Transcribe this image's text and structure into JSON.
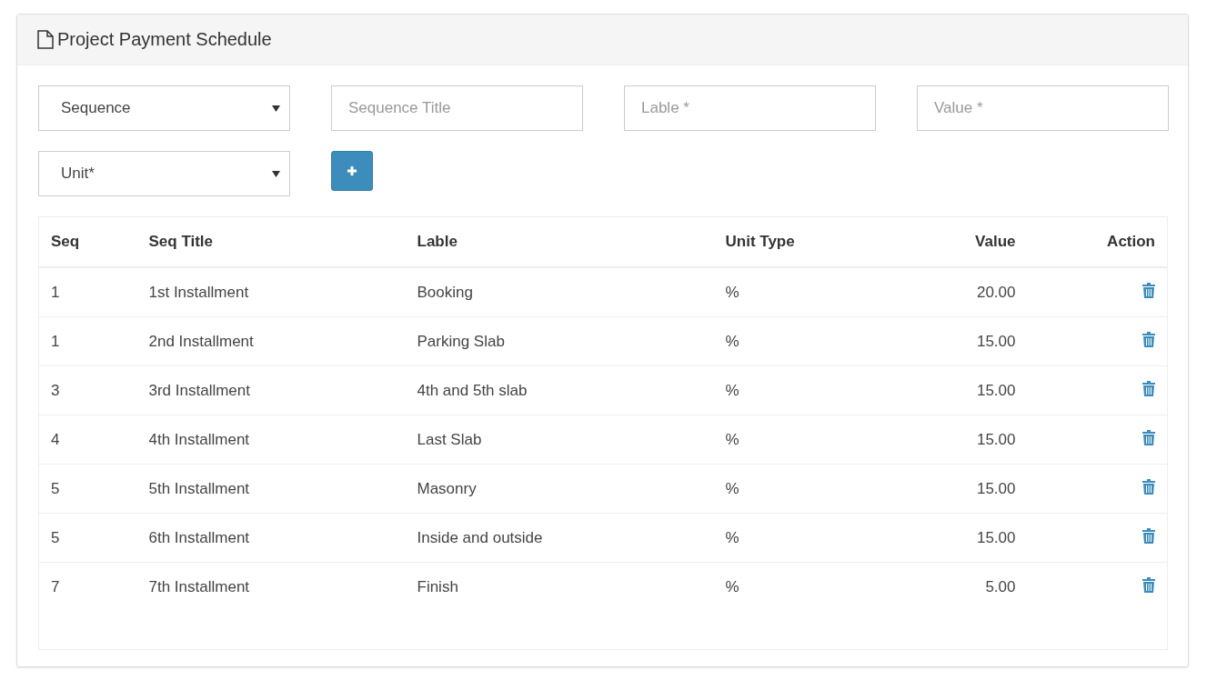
{
  "panel": {
    "title": "Project Payment Schedule"
  },
  "form": {
    "fields": [
      {
        "kind": "select",
        "value": "Sequence"
      },
      {
        "kind": "input",
        "placeholder": "Sequence Title"
      },
      {
        "kind": "input",
        "placeholder": "Lable *"
      },
      {
        "kind": "input",
        "placeholder": "Value *"
      },
      {
        "kind": "select",
        "value": "Unit*"
      },
      {
        "kind": "add"
      }
    ]
  },
  "table": {
    "columns": [
      "Seq",
      "Seq Title",
      "Lable",
      "Unit Type",
      "Value",
      "Action"
    ],
    "rows": [
      {
        "seq": "1",
        "title": "1st Installment",
        "label": "Booking",
        "unit": "%",
        "value": "20.00"
      },
      {
        "seq": "1",
        "title": "2nd Installment",
        "label": "Parking Slab",
        "unit": "%",
        "value": "15.00"
      },
      {
        "seq": "3",
        "title": "3rd Installment",
        "label": "4th and 5th slab",
        "unit": "%",
        "value": "15.00"
      },
      {
        "seq": "4",
        "title": "4th Installment",
        "label": "Last Slab",
        "unit": "%",
        "value": "15.00"
      },
      {
        "seq": "5",
        "title": "5th Installment",
        "label": "Masonry",
        "unit": "%",
        "value": "15.00"
      },
      {
        "seq": "5",
        "title": "6th Installment",
        "label": "Inside and outside",
        "unit": "%",
        "value": "15.00"
      },
      {
        "seq": "7",
        "title": "7th Installment",
        "label": "Finish",
        "unit": "%",
        "value": "5.00"
      }
    ]
  }
}
